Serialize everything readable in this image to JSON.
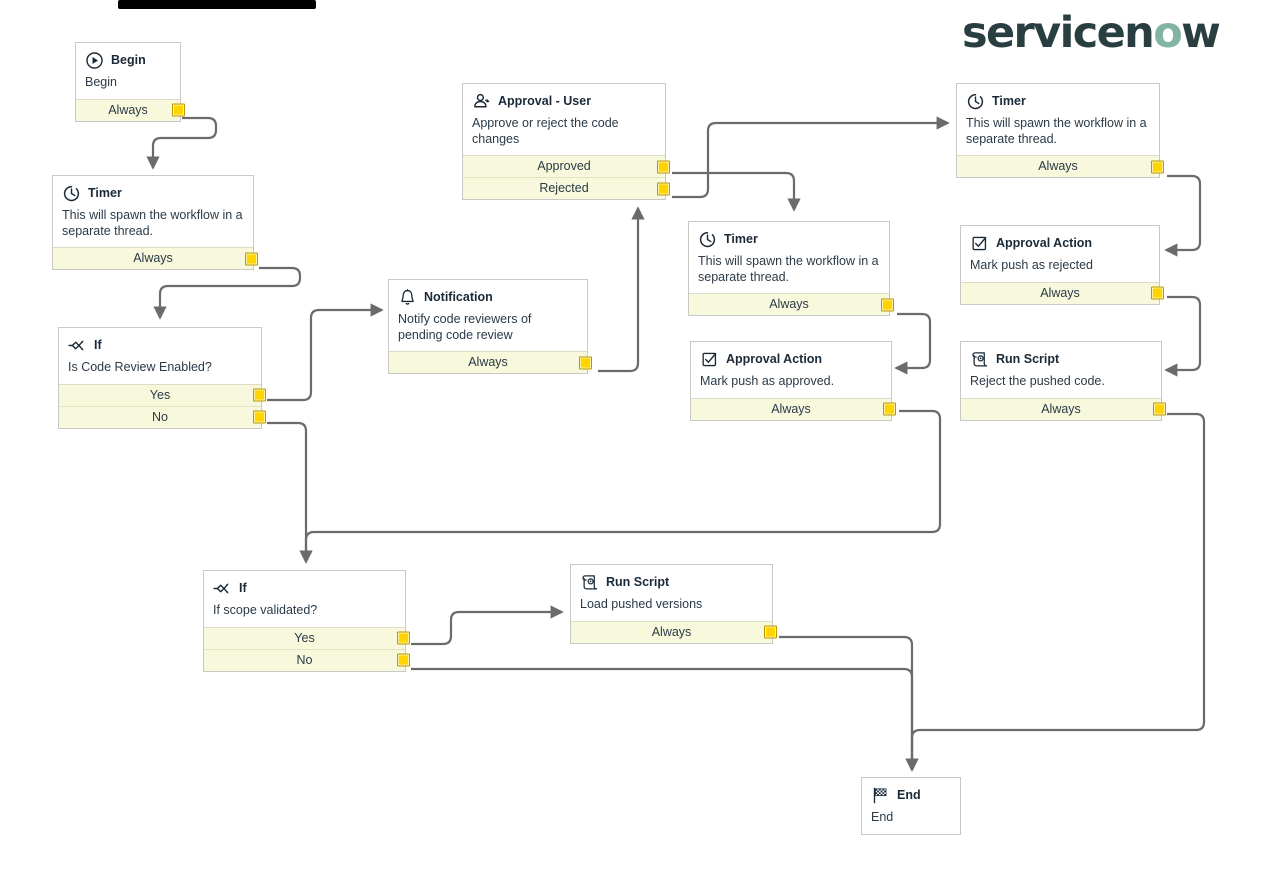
{
  "brand": {
    "logo_text_1": "servicen",
    "logo_text_o": "o",
    "logo_text_2": "w",
    "logo_color": "#293e40",
    "logo_accent_color": "#81b5a1"
  },
  "theme": {
    "node_border": "#c8c8c8",
    "node_bg": "#ffffff",
    "port_bg": "#f8f8dc",
    "knob_color": "#ffd400",
    "connector_color": "#6b6b6b",
    "title_color": "#1b2a38"
  },
  "nodes": [
    {
      "id": "begin",
      "icon": "play-circle-icon",
      "title": "Begin",
      "desc": "Begin",
      "ports": [
        "Always"
      ]
    },
    {
      "id": "timer-left",
      "icon": "timer-icon",
      "title": "Timer",
      "desc": "This will spawn the workflow in a separate thread.",
      "ports": [
        "Always"
      ]
    },
    {
      "id": "if-code-review",
      "icon": "if-branch-icon",
      "title": "If",
      "desc": "Is Code Review Enabled?",
      "ports": [
        "Yes",
        "No"
      ]
    },
    {
      "id": "notification",
      "icon": "bell-icon",
      "title": "Notification",
      "desc": "Notify code reviewers of pending code review",
      "ports": [
        "Always"
      ]
    },
    {
      "id": "approval-user",
      "icon": "user-approval-icon",
      "title": "Approval - User",
      "desc": "Approve or reject the code changes",
      "ports": [
        "Approved",
        "Rejected"
      ]
    },
    {
      "id": "timer-mid",
      "icon": "timer-icon",
      "title": "Timer",
      "desc": "This will spawn the workflow in a separate thread.",
      "ports": [
        "Always"
      ]
    },
    {
      "id": "approval-action-approved",
      "icon": "checkbox-icon",
      "title": "Approval Action",
      "desc": "Mark push as approved.",
      "ports": [
        "Always"
      ]
    },
    {
      "id": "timer-right",
      "icon": "timer-icon",
      "title": "Timer",
      "desc": "This will spawn the workflow in a separate thread.",
      "ports": [
        "Always"
      ]
    },
    {
      "id": "approval-action-rejected",
      "icon": "checkbox-icon",
      "title": "Approval Action",
      "desc": "Mark push as rejected",
      "ports": [
        "Always"
      ]
    },
    {
      "id": "run-script-reject",
      "icon": "script-icon",
      "title": "Run Script",
      "desc": "Reject the pushed code.",
      "ports": [
        "Always"
      ]
    },
    {
      "id": "if-scope",
      "icon": "if-branch-icon",
      "title": "If",
      "desc": "If scope validated?",
      "ports": [
        "Yes",
        "No"
      ]
    },
    {
      "id": "run-script-load",
      "icon": "script-icon",
      "title": "Run Script",
      "desc": "Load pushed versions",
      "ports": [
        "Always"
      ]
    },
    {
      "id": "end",
      "icon": "checkered-flag-icon",
      "title": "End",
      "desc": "End",
      "ports": []
    }
  ]
}
